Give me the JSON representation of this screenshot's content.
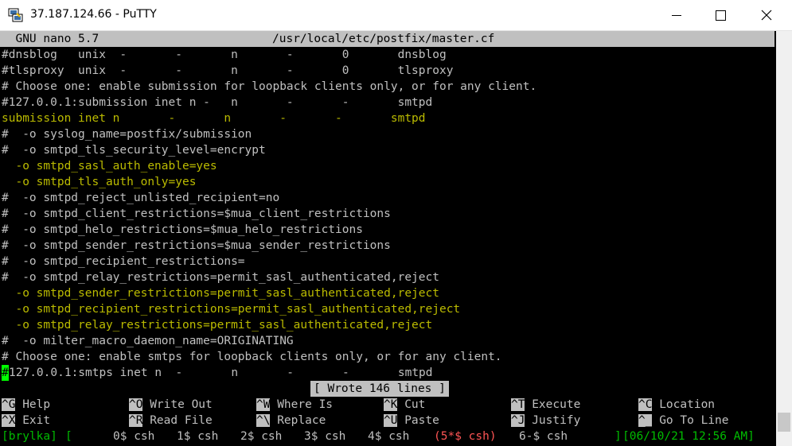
{
  "window": {
    "title": "37.187.124.66 - PuTTY"
  },
  "nano": {
    "header_left": "  GNU nano 5.7",
    "header_file": "/usr/local/etc/postfix/master.cf",
    "status": "[ Wrote 146 lines ]"
  },
  "lines": [
    "#dnsblog   unix  -       -       n       -       0       dnsblog",
    "#tlsproxy  unix  -       -       n       -       0       tlsproxy",
    "# Choose one: enable submission for loopback clients only, or for any client.",
    "#127.0.0.1:submission inet n -   n       -       -       smtpd",
    "submission inet n       -       n       -       -       smtpd",
    "#  -o syslog_name=postfix/submission",
    "#  -o smtpd_tls_security_level=encrypt",
    "  -o smtpd_sasl_auth_enable=yes",
    "  -o smtpd_tls_auth_only=yes",
    "#  -o smtpd_reject_unlisted_recipient=no",
    "#  -o smtpd_client_restrictions=$mua_client_restrictions",
    "#  -o smtpd_helo_restrictions=$mua_helo_restrictions",
    "#  -o smtpd_sender_restrictions=$mua_sender_restrictions",
    "#  -o smtpd_recipient_restrictions=",
    "#  -o smtpd_relay_restrictions=permit_sasl_authenticated,reject",
    "  -o smtpd_sender_restrictions=permit_sasl_authenticated,reject",
    "  -o smtpd_recipient_restrictions=permit_sasl_authenticated,reject",
    "  -o smtpd_relay_restrictions=permit_sasl_authenticated,reject",
    "#  -o milter_macro_daemon_name=ORIGINATING",
    "# Choose one: enable smtps for loopback clients only, or for any client.",
    "127.0.0.1:smtps inet n  -       n       -       -       smtpd"
  ],
  "cursor_char": "#",
  "shortcuts": {
    "row1": [
      {
        "key": "^G",
        "label": " Help"
      },
      {
        "key": "^O",
        "label": " Write Out"
      },
      {
        "key": "^W",
        "label": " Where Is"
      },
      {
        "key": "^K",
        "label": " Cut"
      },
      {
        "key": "^T",
        "label": " Execute"
      },
      {
        "key": "^C",
        "label": " Location"
      }
    ],
    "row2": [
      {
        "key": "^X",
        "label": " Exit"
      },
      {
        "key": "^R",
        "label": " Read File"
      },
      {
        "key": "^\\",
        "label": " Replace"
      },
      {
        "key": "^U",
        "label": " Paste"
      },
      {
        "key": "^J",
        "label": " Justify"
      },
      {
        "key": "^_",
        "label": " Go To Line"
      }
    ]
  },
  "screen_bar": {
    "host": "[brylka]",
    "open_bracket": "[",
    "w0": "0$ csh",
    "w1": "1$ csh",
    "w2": "2$ csh",
    "w3": "3$ csh",
    "w4": "4$ csh",
    "w5": "(5*$ csh)",
    "w6": "6-$ csh",
    "close_bracket": "]",
    "datetime": "[06/10/21 12:56 AM]"
  }
}
